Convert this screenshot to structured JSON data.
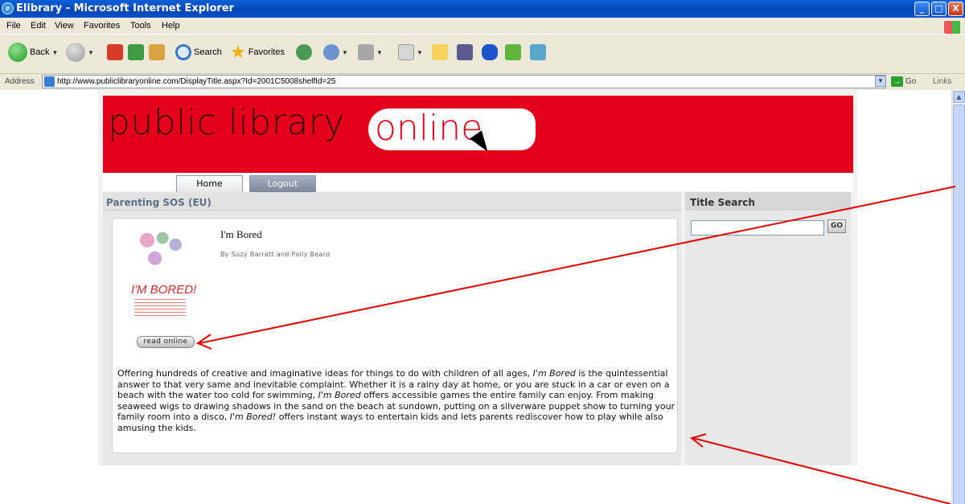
{
  "window": {
    "title": "Elibrary - Microsoft Internet Explorer",
    "min": "_",
    "max": "□",
    "close": "X"
  },
  "menu": [
    "File",
    "Edit",
    "View",
    "Favorites",
    "Tools",
    "Help"
  ],
  "toolbar": {
    "back": "Back",
    "search": "Search",
    "favorites": "Favorites"
  },
  "address": {
    "label": "Address",
    "url": "http://www.publiclibraryonline.com/DisplayTitle.aspx?Id=2001C5008shelfId=25",
    "go": "Go",
    "links": "Links"
  },
  "site": {
    "logo_text": "public library",
    "logo_online": "online",
    "tabs": {
      "home": "Home",
      "logout": "Logout"
    },
    "shelf_title": "Parenting SOS (EU)",
    "search_title": "Title Search",
    "search_value": "",
    "search_go": "GO"
  },
  "book": {
    "title": "I'm Bored",
    "author": "By Suzy Barratt and Polly Beard",
    "cover_text": "I'M BORED!",
    "read_button": "read online",
    "description": [
      "Offering hundreds of creative and imaginative ideas for things to do with children of all ages, ",
      "I'm Bored",
      " is the quintessential answer to that very same and inevitable complaint. Whether it is a rainy day at home, or you are stuck in a car or even on a beach with the water too cold for swimming, ",
      "I'm Bored",
      " offers accessible games the entire family can enjoy. From making seaweed wigs to drawing shadows in the sand on the beach at sundown, putting on a silverware puppet show to turning your family room into a disco, ",
      "I'm Bored!",
      " offers instant ways to entertain kids and lets parents rediscover how to play while also amusing the kids."
    ]
  },
  "colors": {
    "brand_red": "#e4001b",
    "xp_blue": "#0446b4",
    "annotation_red": "#e00000"
  }
}
